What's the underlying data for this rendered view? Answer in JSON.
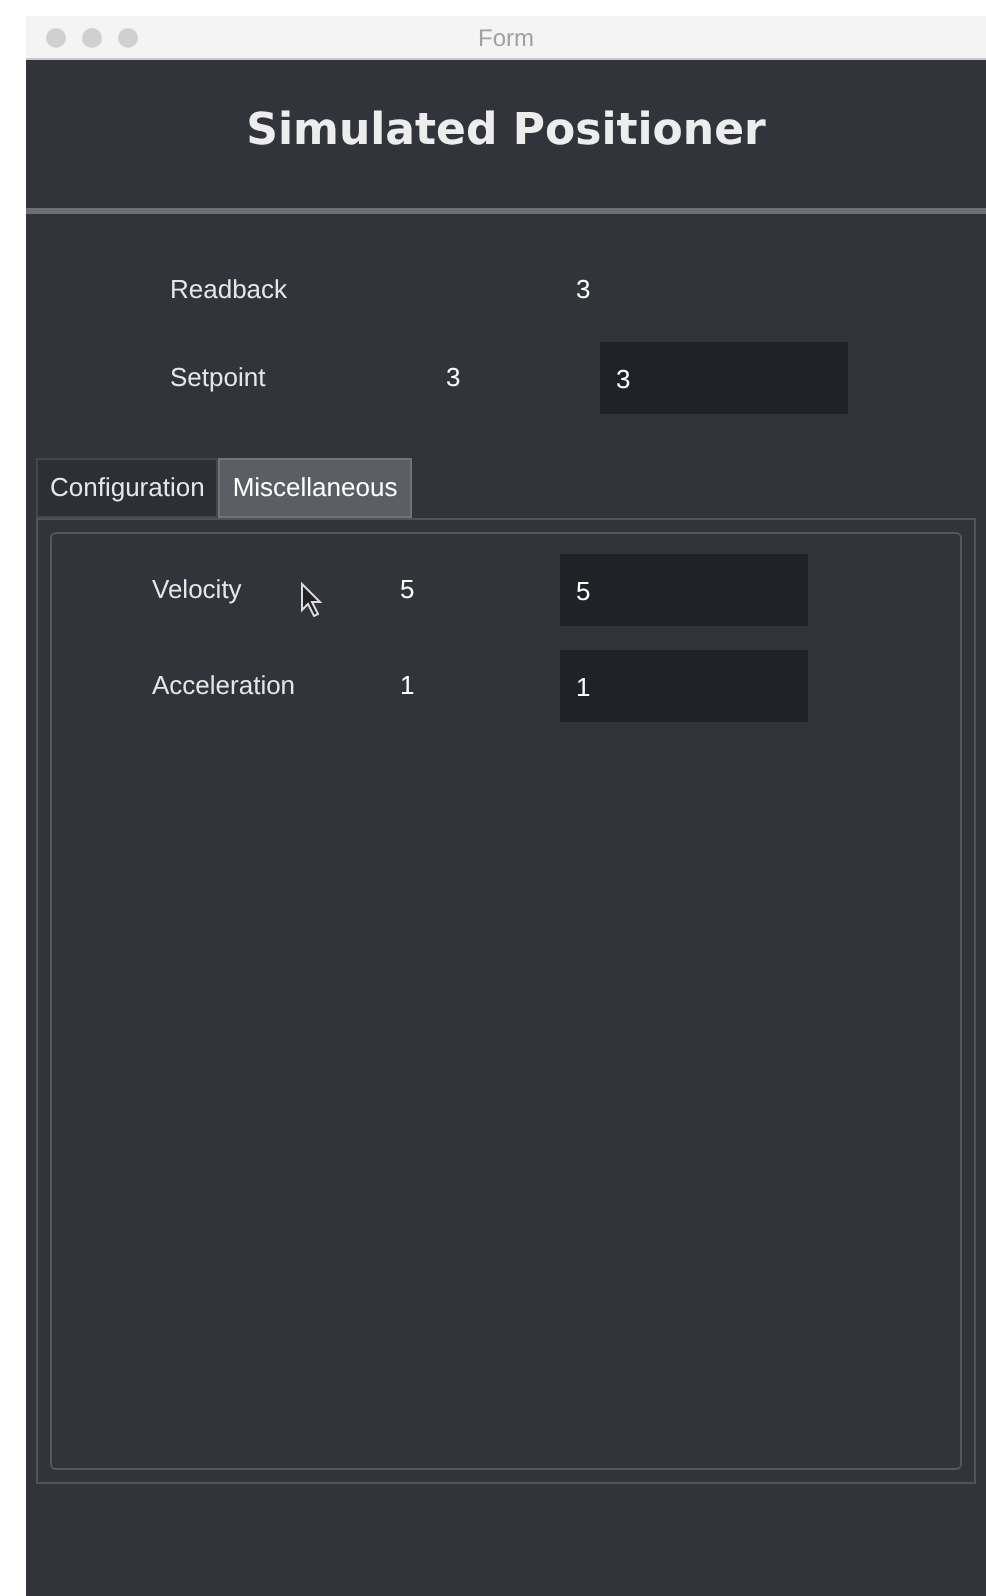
{
  "window": {
    "title": "Form"
  },
  "heading": "Simulated Positioner",
  "readback": {
    "label": "Readback",
    "value": "3"
  },
  "setpoint": {
    "label": "Setpoint",
    "value": "3",
    "input": "3"
  },
  "tabs": [
    {
      "label": "Configuration",
      "selected": false
    },
    {
      "label": "Miscellaneous",
      "selected": true
    }
  ],
  "rows": [
    {
      "label": "Velocity",
      "value": "5",
      "input": "5",
      "cursor": true
    },
    {
      "label": "Acceleration",
      "value": "1",
      "input": "1",
      "cursor": false
    }
  ]
}
